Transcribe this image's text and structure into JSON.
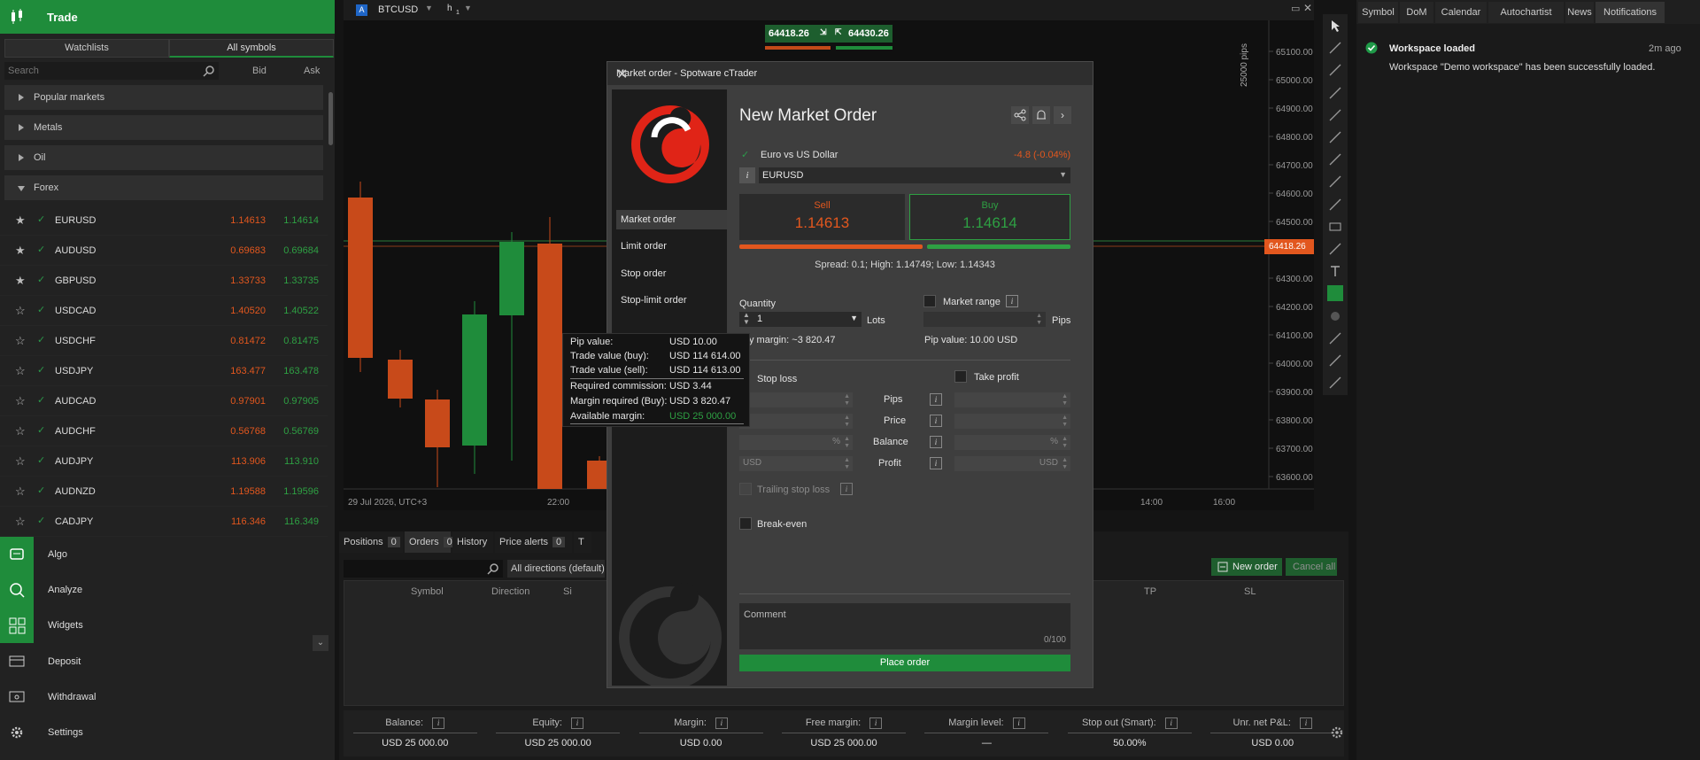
{
  "left_panel": {
    "trade_title": "Trade",
    "tabs": {
      "watchlists": "Watchlists",
      "all_symbols": "All symbols"
    },
    "search_placeholder": "Search",
    "bid_header": "Bid",
    "ask_header": "Ask",
    "categories": [
      "Popular markets",
      "Metals",
      "Oil",
      "Forex"
    ],
    "symbols": [
      {
        "name": "EURUSD",
        "bid": "1.14613",
        "ask": "1.14614",
        "fav": "★"
      },
      {
        "name": "AUDUSD",
        "bid": "0.69683",
        "ask": "0.69684",
        "fav": "★"
      },
      {
        "name": "GBPUSD",
        "bid": "1.33733",
        "ask": "1.33735",
        "fav": "★"
      },
      {
        "name": "USDCAD",
        "bid": "1.40520",
        "ask": "1.40522",
        "fav": "☆"
      },
      {
        "name": "USDCHF",
        "bid": "0.81472",
        "ask": "0.81475",
        "fav": "☆"
      },
      {
        "name": "USDJPY",
        "bid": "163.477",
        "ask": "163.478",
        "fav": "☆"
      },
      {
        "name": "AUDCAD",
        "bid": "0.97901",
        "ask": "0.97905",
        "fav": "☆"
      },
      {
        "name": "AUDCHF",
        "bid": "0.56768",
        "ask": "0.56769",
        "fav": "☆"
      },
      {
        "name": "AUDJPY",
        "bid": "113.906",
        "ask": "113.910",
        "fav": "☆"
      },
      {
        "name": "AUDNZD",
        "bid": "1.19588",
        "ask": "1.19596",
        "fav": "☆"
      },
      {
        "name": "CADJPY",
        "bid": "116.346",
        "ask": "116.349",
        "fav": "☆"
      }
    ],
    "nav": [
      "Algo",
      "Analyze",
      "Widgets",
      "Deposit",
      "Withdrawal",
      "Settings"
    ]
  },
  "chart": {
    "symbol": "BTCUSD",
    "timeframe": "h",
    "timeframe_sub": "1",
    "sell_tag": "64418.26",
    "buy_tag": "64430.26",
    "price_label": "64418.26",
    "pips_label": "25000 pips",
    "y_ticks": [
      "65100.00",
      "65000.00",
      "64900.00",
      "64800.00",
      "64700.00",
      "64600.00",
      "64500.00",
      "64400.00",
      "64300.00",
      "64200.00",
      "64100.00",
      "64000.00",
      "63900.00",
      "63800.00",
      "63700.00",
      "63600.00"
    ],
    "x_date": "29 Jul 2026, UTC+3",
    "x_ticks": [
      "22:00",
      "14:00",
      "16:00"
    ]
  },
  "bottom": {
    "tabs": [
      {
        "label": "Positions",
        "count": "0"
      },
      {
        "label": "Orders",
        "count": "0"
      },
      {
        "label": "History",
        "count": ""
      },
      {
        "label": "Price alerts",
        "count": "0"
      },
      {
        "label": "T",
        "count": ""
      }
    ],
    "direction_filter": "All directions (default)",
    "new_order": "New order",
    "cancel_all": "Cancel all",
    "columns": [
      "Symbol",
      "Direction",
      "Si",
      "TP",
      "SL"
    ],
    "footer": [
      {
        "label": "Balance:",
        "value": "USD 25 000.00"
      },
      {
        "label": "Equity:",
        "value": "USD 25 000.00"
      },
      {
        "label": "Margin:",
        "value": "USD 0.00"
      },
      {
        "label": "Free margin:",
        "value": "USD 25 000.00"
      },
      {
        "label": "Margin level:",
        "value": "—"
      },
      {
        "label": "Stop out (Smart):",
        "value": "50.00%"
      },
      {
        "label": "Unr. net P&L:",
        "value": "USD 0.00"
      }
    ]
  },
  "right_panel": {
    "tabs": [
      "Symbol",
      "DoM",
      "Calendar",
      "Autochartist",
      "News",
      "Notifications"
    ],
    "notification": {
      "title": "Workspace loaded",
      "time": "2m ago",
      "body": "Workspace \"Demo workspace\" has been successfully loaded."
    }
  },
  "modal": {
    "window_title": "Market order - Spotware cTrader",
    "heading": "New Market Order",
    "sidebar": [
      "Market order",
      "Limit order",
      "Stop order",
      "Stop-limit order"
    ],
    "symbol_desc": "Euro vs US Dollar",
    "change": "-4.8 (-0.04%)",
    "symbol": "EURUSD",
    "sell_label": "Sell",
    "sell_price": "1.14613",
    "buy_label": "Buy",
    "buy_price": "1.14614",
    "spread_text": "Spread: 0.1; High: 1.14749; Low: 1.14343",
    "quantity_label": "Quantity",
    "quantity_value": "1",
    "lots_label": "Lots",
    "market_range": "Market range",
    "pips_unit": "Pips",
    "margin_text": "y margin: ~3 820.47",
    "pip_value_text": "Pip value: 10.00 USD",
    "stop_loss": "Stop loss",
    "take_profit": "Take profit",
    "row_labels": [
      "Pips",
      "Price",
      "Balance",
      "Profit"
    ],
    "pct": "%",
    "usd_placeholder": "USD",
    "trailing": "Trailing stop loss",
    "breakeven": "Break-even",
    "comment_placeholder": "Comment",
    "comment_count": "0/100",
    "place_order": "Place order",
    "info_i": "i"
  },
  "tooltip": {
    "rows": [
      {
        "label": "Pip value:",
        "value": "USD 10.00"
      },
      {
        "label": "Trade value (buy):",
        "value": "USD 114 614.00"
      },
      {
        "label": "Trade value (sell):",
        "value": "USD 114 613.00"
      },
      {
        "label": "Required commission:",
        "value": "USD 3.44"
      },
      {
        "label": "Margin required (Buy):",
        "value": "USD 3 820.47"
      },
      {
        "label": "Available margin:",
        "value": "USD 25 000.00"
      }
    ]
  },
  "colors": {
    "accent": "#1f8c3b",
    "sell": "#e2571e",
    "buy": "#2ea043"
  }
}
